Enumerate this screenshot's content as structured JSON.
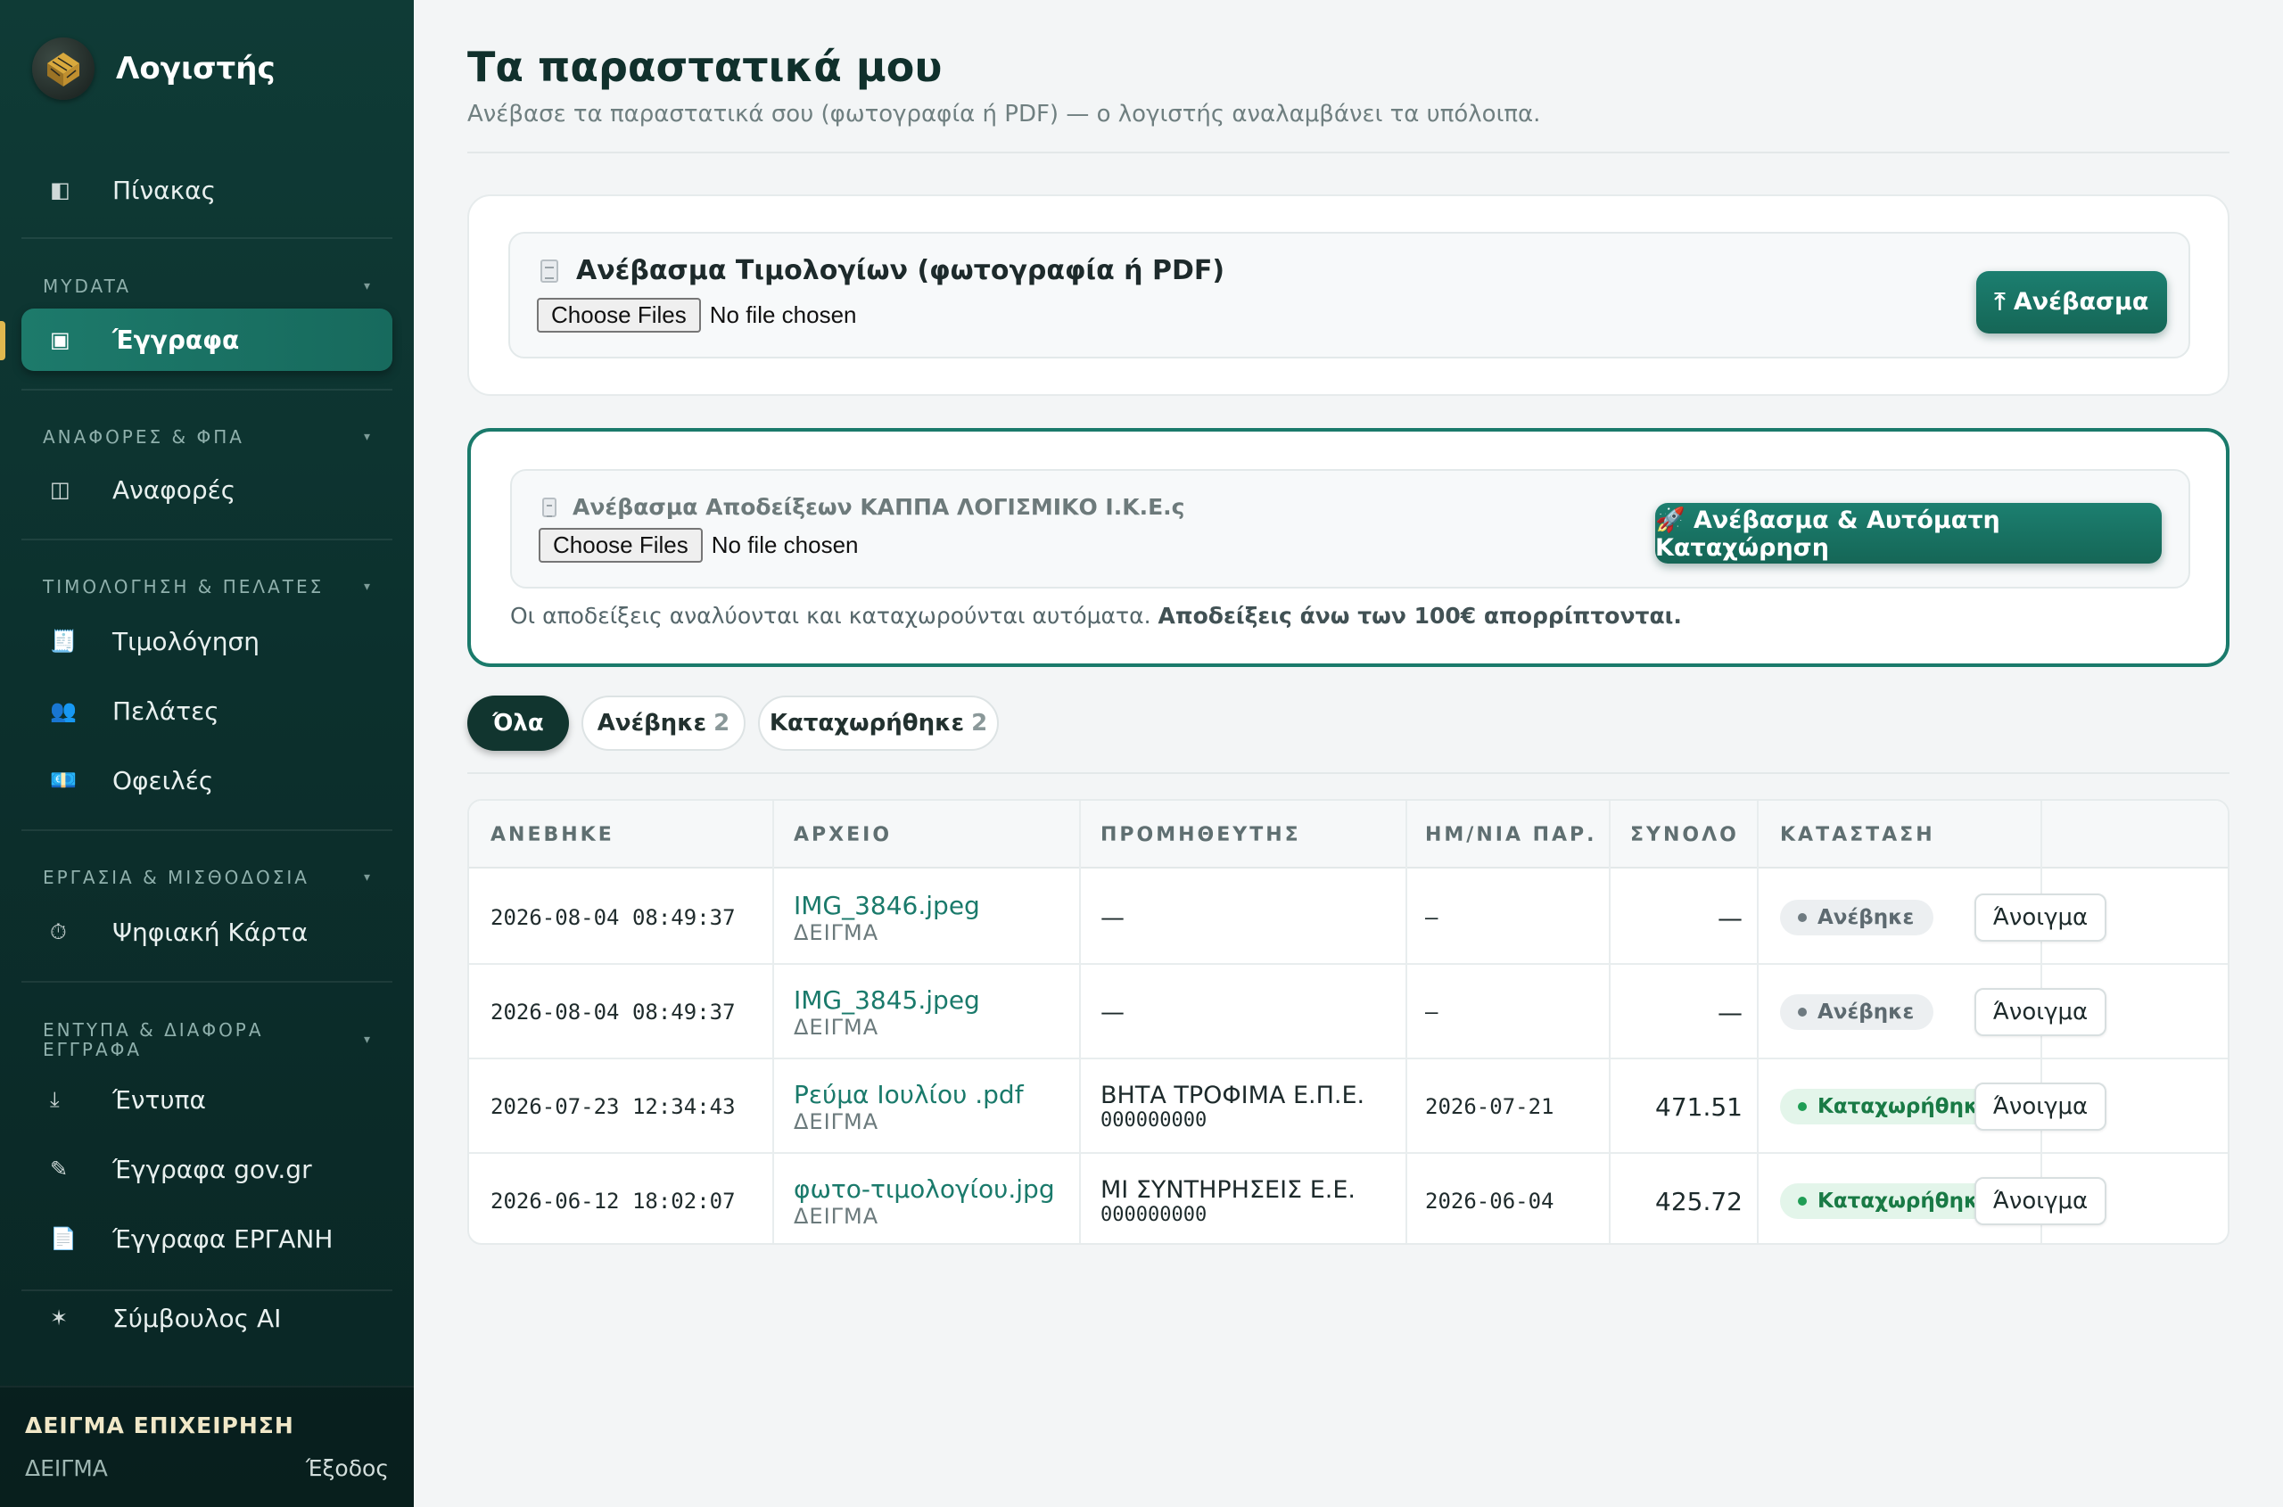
{
  "app": {
    "name": "Λογιστής"
  },
  "sidebar": {
    "dashboard": {
      "icon": "◧",
      "label": "Πίνακας"
    },
    "sections": [
      {
        "title": "MYDATA",
        "items": [
          {
            "icon": "▣",
            "label": "Έγγραφα",
            "active": true
          }
        ]
      },
      {
        "title": "ΑΝΑΦΟΡΕΣ & ΦΠΑ",
        "items": [
          {
            "icon": "◫",
            "label": "Αναφορές"
          }
        ]
      },
      {
        "title": "ΤΙΜΟΛΟΓΗΣΗ & ΠΕΛΑΤΕΣ",
        "items": [
          {
            "icon": "🧾",
            "label": "Τιμολόγηση"
          },
          {
            "icon": "👥",
            "label": "Πελάτες"
          },
          {
            "icon": "💶",
            "label": "Οφειλές"
          }
        ]
      },
      {
        "title": "ΕΡΓΑΣΙΑ & ΜΙΣΘΟΔΟΣΙΑ",
        "items": [
          {
            "icon": "⏱",
            "label": "Ψηφιακή Κάρτα"
          }
        ]
      },
      {
        "title": "ΕΝΤΥΠΑ & ΔΙΑΦΟΡΑ ΕΓΓΡΑΦΑ",
        "items": [
          {
            "icon": "⤓",
            "label": "Έντυπα"
          },
          {
            "icon": "✎",
            "label": "Έγγραφα gov.gr"
          },
          {
            "icon": "📄",
            "label": "Έγγραφα ΕΡΓΑΝΗ"
          }
        ]
      }
    ],
    "ai": {
      "icon": "✶",
      "label": "Σύμβουλος AI"
    },
    "footer": {
      "business": "ΔΕΙΓΜΑ ΕΠΙΧΕΙΡΗΣΗ",
      "user": "ΔΕΙΓΜΑ",
      "logout": "Έξοδος"
    }
  },
  "page": {
    "title": "Τα παραστατικά μου",
    "subtitle": "Ανέβασε τα παραστατικά σου (φωτογραφία ή PDF) — ο λογιστής αναλαμβάνει τα υπόλοιπα."
  },
  "invoice_upload": {
    "title": "Ανέβασμα Τιμολογίων (φωτογραφία ή PDF)",
    "choose_label": "Choose Files",
    "no_file": "No file chosen",
    "button": "⤒ Ανέβασμα"
  },
  "receipt_upload": {
    "title": "Ανέβασμα Αποδείξεων ΚΑΠΠΑ ΛΟΓΙΣΜΙΚΟ Ι.Κ.Ε.ς",
    "choose_label": "Choose Files",
    "no_file": "No file chosen",
    "button": "🚀 Ανέβασμα & Αυτόματη Καταχώρηση",
    "note": "Οι αποδείξεις αναλύονται και καταχωρούνται αυτόματα.",
    "note_bold": "Αποδείξεις άνω των 100€ απορρίπτονται."
  },
  "filters": [
    {
      "label": "Όλα",
      "count": "",
      "active": true
    },
    {
      "label": "Ανέβηκε",
      "count": "2",
      "active": false
    },
    {
      "label": "Καταχωρήθηκε",
      "count": "2",
      "active": false
    }
  ],
  "table": {
    "columns": [
      "ΑΝΕΒΗΚΕ",
      "ΑΡΧΕΙΟ",
      "ΠΡΟΜΗΘΕΥΤΗΣ",
      "ΗΜ/ΝΙΑ ΠΑΡ.",
      "ΣΥΝΟΛΟ",
      "ΚΑΤΑΣΤΑΣΗ"
    ],
    "open_label": "Άνοιγμα",
    "rows": [
      {
        "uploaded": "2026-08-04 08:49:37",
        "file": "IMG_3846.jpeg",
        "file_sub": "ΔΕΙΓΜΑ",
        "supplier": "—",
        "afm": "",
        "doc_date": "–",
        "total": "—",
        "status": "Ανέβηκε",
        "status_type": "up"
      },
      {
        "uploaded": "2026-08-04 08:49:37",
        "file": "IMG_3845.jpeg",
        "file_sub": "ΔΕΙΓΜΑ",
        "supplier": "—",
        "afm": "",
        "doc_date": "–",
        "total": "—",
        "status": "Ανέβηκε",
        "status_type": "up"
      },
      {
        "uploaded": "2026-07-23 12:34:43",
        "file": "Ρεύμα Ιουλίου .pdf",
        "file_sub": "ΔΕΙΓΜΑ",
        "supplier": "ΒΗΤΑ ΤΡΟΦΙΜΑ Ε.Π.Ε.",
        "afm": "000000000",
        "doc_date": "2026-07-21",
        "total": "471.51",
        "status": "Καταχωρήθηκε",
        "status_type": "ok"
      },
      {
        "uploaded": "2026-06-12 18:02:07",
        "file": "φωτο-τιμολογίου.jpg",
        "file_sub": "ΔΕΙΓΜΑ",
        "supplier": "ΜΙ ΣΥΝΤΗΡΗΣΕΙΣ Ε.Ε.",
        "afm": "000000000",
        "doc_date": "2026-06-04",
        "total": "425.72",
        "status": "Καταχωρήθηκε",
        "status_type": "ok"
      }
    ]
  }
}
